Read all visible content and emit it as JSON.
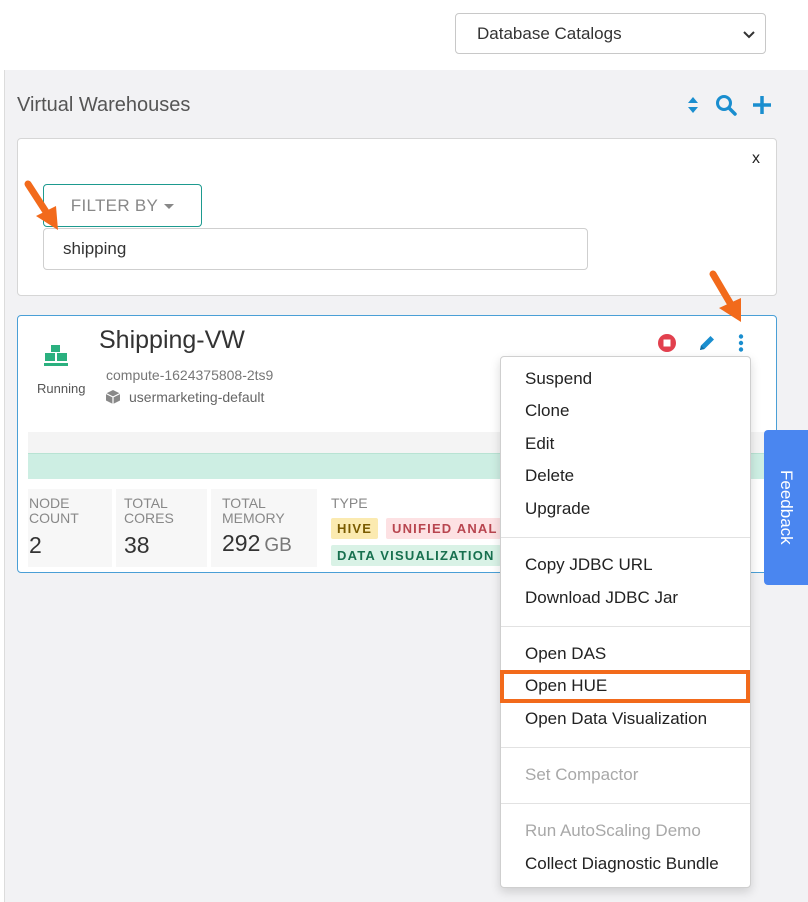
{
  "header": {
    "catalog_select": "Database Catalogs"
  },
  "section": {
    "title": "Virtual Warehouses",
    "icons": [
      "sort-icon",
      "search-icon",
      "plus-icon"
    ]
  },
  "filter": {
    "close_label": "x",
    "button_label": "FILTER BY",
    "input_value": "shipping"
  },
  "warehouse": {
    "name": "Shipping-VW",
    "status": "Running",
    "compute": "compute-1624375808-2ts9",
    "environment": "usermarketing-default",
    "stats": {
      "node_count_label_1": "NODE",
      "node_count_label_2": "COUNT",
      "node_count": "2",
      "total_cores_label_1": "TOTAL",
      "total_cores_label_2": "CORES",
      "total_cores": "38",
      "total_memory_label_1": "TOTAL",
      "total_memory_label_2": "MEMORY",
      "total_memory": "292",
      "total_memory_unit": "GB",
      "type_label": "TYPE"
    },
    "tags": {
      "hive": "HIVE",
      "unified": "UNIFIED ANAL",
      "dataviz": "DATA VISUALIZATION"
    }
  },
  "menu": {
    "items": [
      "Suspend",
      "Clone",
      "Edit",
      "Delete",
      "Upgrade",
      "Copy JDBC URL",
      "Download JDBC Jar",
      "Open DAS",
      "Open HUE",
      "Open Data Visualization",
      "Set Compactor",
      "Run AutoScaling Demo",
      "Collect Diagnostic Bundle"
    ],
    "highlighted": "Open HUE"
  },
  "feedback": {
    "label": "Feedback"
  },
  "colors": {
    "accent": "#1a8ecf",
    "teal": "#1d9a8f",
    "annotation": "#f26a1b",
    "stop": "#e2404e",
    "feedback_bg": "#4a86f0"
  }
}
